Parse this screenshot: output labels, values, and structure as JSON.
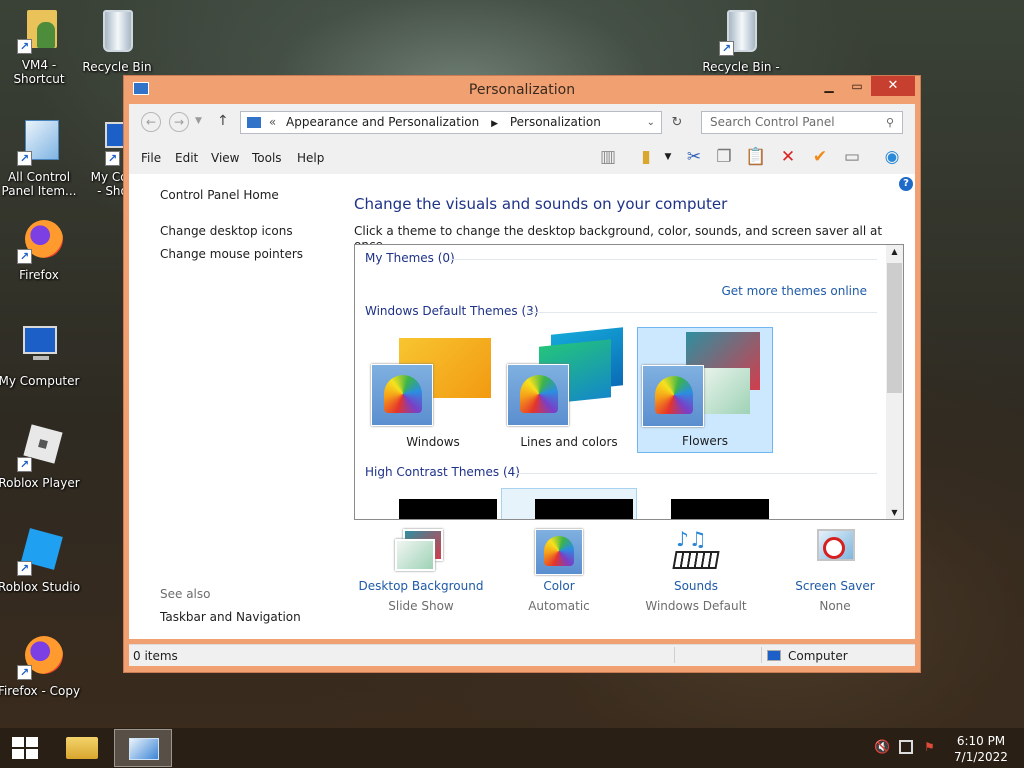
{
  "desktop": {
    "icons": [
      {
        "label": "VM4 -\nShortcut"
      },
      {
        "label": "Recycle Bin"
      },
      {
        "label": "All Control\nPanel Item..."
      },
      {
        "label": "My Com\n- Shor"
      },
      {
        "label": "Firefox"
      },
      {
        "label": "My Computer"
      },
      {
        "label": "Roblox Player"
      },
      {
        "label": "Roblox Studio"
      },
      {
        "label": "Firefox - Copy"
      },
      {
        "label": "Recycle Bin -"
      }
    ]
  },
  "window": {
    "title": "Personalization",
    "breadcrumb": {
      "prefix": "«",
      "items": [
        "Appearance and Personalization",
        "Personalization"
      ]
    },
    "search_placeholder": "Search Control Panel",
    "menu": [
      "File",
      "Edit",
      "View",
      "Tools",
      "Help"
    ],
    "left_links": [
      "Control Panel Home",
      "Change desktop icons",
      "Change mouse pointers"
    ],
    "see_also": {
      "label": "See also",
      "links": [
        "Taskbar and Navigation"
      ]
    },
    "heading": "Change the visuals and sounds on your computer",
    "subheading": "Click a theme to change the desktop background, color, sounds, and screen saver all at once.",
    "groups": {
      "my": "My Themes (0)",
      "default": "Windows Default Themes (3)",
      "high_contrast": "High Contrast Themes (4)"
    },
    "get_more": "Get more themes online",
    "themes": [
      {
        "name": "Windows",
        "selected": false
      },
      {
        "name": "Lines and colors",
        "selected": false
      },
      {
        "name": "Flowers",
        "selected": true
      }
    ],
    "bottom": [
      {
        "label": "Desktop Background",
        "value": "Slide Show"
      },
      {
        "label": "Color",
        "value": "Automatic"
      },
      {
        "label": "Sounds",
        "value": "Windows Default"
      },
      {
        "label": "Screen Saver",
        "value": "None"
      }
    ],
    "status": {
      "items": "0 items",
      "computer": "Computer"
    }
  },
  "taskbar": {
    "time": "6:10 PM",
    "date": "7/1/2022"
  }
}
